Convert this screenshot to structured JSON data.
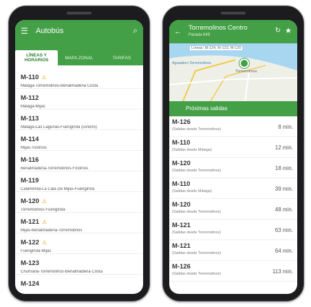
{
  "left": {
    "title": "Autobús",
    "tabs": [
      {
        "label": "LÍNEAS Y HORARIOS"
      },
      {
        "label": "MAPA ZONAL"
      },
      {
        "label": "TARIFAS"
      }
    ],
    "routes": [
      {
        "code": "M-110",
        "warn": true,
        "desc": "Málaga-Torremolinos-Benalmádena Costa"
      },
      {
        "code": "M-112",
        "warn": false,
        "desc": "Málaga-Mijas"
      },
      {
        "code": "M-113",
        "warn": false,
        "desc": "Málaga-Las Lagunas-Fuengirola (Directo)"
      },
      {
        "code": "M-114",
        "warn": false,
        "desc": "Mijas-Tostinos"
      },
      {
        "code": "M-116",
        "warn": false,
        "desc": "Benalmádena-Torremolinos-Fostinos"
      },
      {
        "code": "M-119",
        "warn": false,
        "desc": "Calahonda-La Cala De Mijas-Fuengirola"
      },
      {
        "code": "M-120",
        "warn": true,
        "desc": "Torremolinos-Fuengirola"
      },
      {
        "code": "M-121",
        "warn": true,
        "desc": "Mijas-Benalmádena-Torremolinos"
      },
      {
        "code": "M-122",
        "warn": true,
        "desc": "Fuengirola-Mijas"
      },
      {
        "code": "M-123",
        "warn": false,
        "desc": "Churriana-Torremolinos-Benalmádena Costa"
      },
      {
        "code": "M-124",
        "warn": false,
        "desc": ""
      }
    ]
  },
  "right": {
    "title": "Torremolinos Centro",
    "subtitle": "Parada 649",
    "map": {
      "label_top": "Líneas: M-124, M-123, M-120",
      "label_left": "Aguadero Torremolinos",
      "label_pin": "Torremolinos"
    },
    "next_header": "Próximas salidas",
    "arrivals": [
      {
        "code": "M-126",
        "dir": "(Salidas desde Torremolinos)",
        "time": "8 min."
      },
      {
        "code": "M-110",
        "dir": "(Salidas desde Málaga)",
        "time": "12 min."
      },
      {
        "code": "M-120",
        "dir": "(Salidas desde Torremolinos)",
        "time": "18 min."
      },
      {
        "code": "M-110",
        "dir": "(Salidas desde Málaga)",
        "time": "39 min."
      },
      {
        "code": "M-120",
        "dir": "(Salidas desde Torremolinos)",
        "time": "48 min."
      },
      {
        "code": "M-121",
        "dir": "(Salidas desde Torremolinos)",
        "time": "63 min."
      },
      {
        "code": "M-121",
        "dir": "(Salidas desde Torremolinos)",
        "time": "64 min."
      },
      {
        "code": "M-126",
        "dir": "(Salidas desde Torremolinos)",
        "time": "113 min."
      }
    ]
  },
  "colors": {
    "accent": "#43a047",
    "warning": "#e6a000"
  },
  "icons": {
    "menu": "menu-icon",
    "search": "search-icon",
    "back": "back-arrow-icon",
    "refresh": "refresh-icon",
    "star": "star-icon",
    "warning": "warning-icon",
    "pin": "map-pin-icon"
  }
}
